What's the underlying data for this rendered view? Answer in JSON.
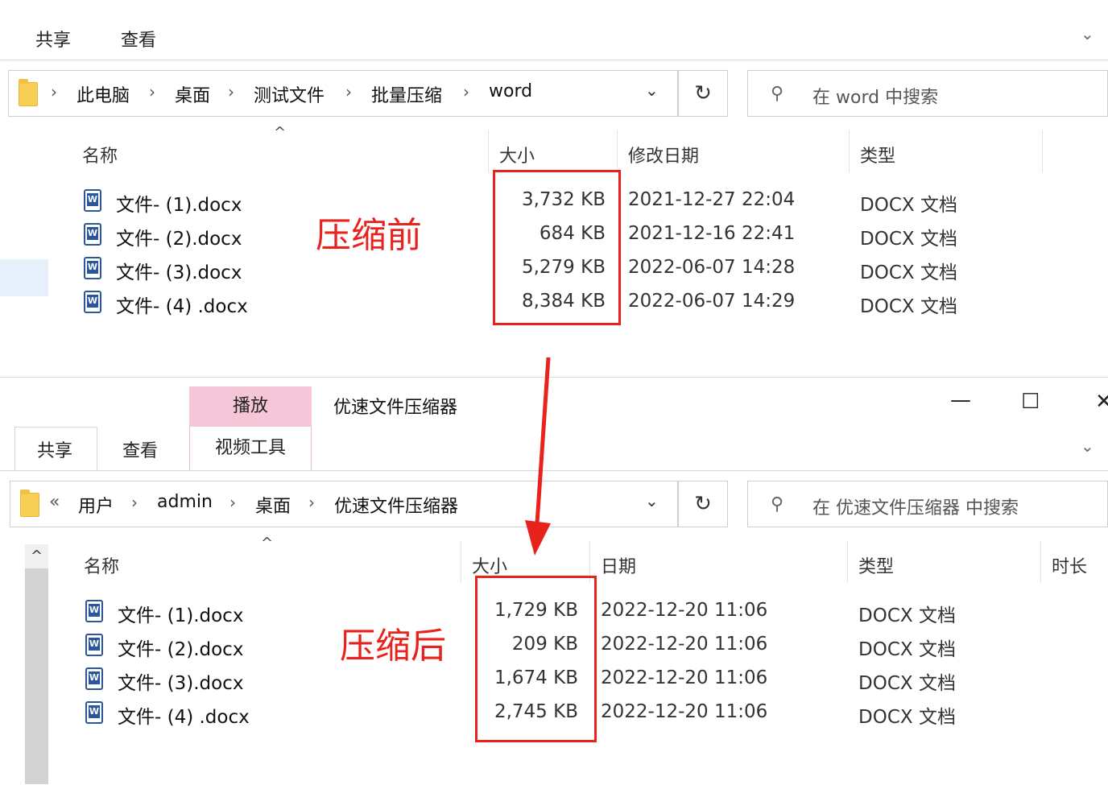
{
  "top_window": {
    "ribbon_tabs": [
      "共享",
      "查看"
    ],
    "breadcrumb": [
      "此电脑",
      "桌面",
      "测试文件",
      "批量压缩",
      "word"
    ],
    "search_placeholder": "在 word 中搜索",
    "columns": [
      "名称",
      "大小",
      "修改日期",
      "类型"
    ],
    "files": [
      {
        "name": "文件- (1).docx",
        "size": "3,732 KB",
        "date": "2021-12-27 22:04",
        "type": "DOCX 文档"
      },
      {
        "name": "文件- (2).docx",
        "size": "684 KB",
        "date": "2021-12-16 22:41",
        "type": "DOCX 文档"
      },
      {
        "name": "文件- (3).docx",
        "size": "5,279 KB",
        "date": "2022-06-07 14:28",
        "type": "DOCX 文档"
      },
      {
        "name": "文件- (4) .docx",
        "size": "8,384 KB",
        "date": "2022-06-07 14:29",
        "type": "DOCX 文档"
      }
    ],
    "annotation": "压缩前"
  },
  "bottom_window": {
    "contextual_tab": "播放",
    "contextual_subtab": "视频工具",
    "title": "优速文件压缩器",
    "ribbon_tabs": [
      "共享",
      "查看"
    ],
    "breadcrumb_prefix": "«",
    "breadcrumb": [
      "用户",
      "admin",
      "桌面",
      "优速文件压缩器"
    ],
    "search_placeholder": "在 优速文件压缩器 中搜索",
    "columns": [
      "名称",
      "大小",
      "日期",
      "类型",
      "时长"
    ],
    "files": [
      {
        "name": "文件- (1).docx",
        "size": "1,729 KB",
        "date": "2022-12-20 11:06",
        "type": "DOCX 文档"
      },
      {
        "name": "文件- (2).docx",
        "size": "209 KB",
        "date": "2022-12-20 11:06",
        "type": "DOCX 文档"
      },
      {
        "name": "文件- (3).docx",
        "size": "1,674 KB",
        "date": "2022-12-20 11:06",
        "type": "DOCX 文档"
      },
      {
        "name": "文件- (4) .docx",
        "size": "2,745 KB",
        "date": "2022-12-20 11:06",
        "type": "DOCX 文档"
      }
    ],
    "annotation": "压缩后",
    "window_buttons": {
      "minimize": "—",
      "maximize": "☐",
      "close": "✕"
    }
  },
  "icons": {
    "chevron": "⌄",
    "separator": "›",
    "refresh": "↻",
    "search": "⚲",
    "sort_up": "^"
  },
  "colors": {
    "annotation": "#e8231e",
    "tool_tab": "#f5c6d7",
    "word_blue": "#2b579a"
  }
}
